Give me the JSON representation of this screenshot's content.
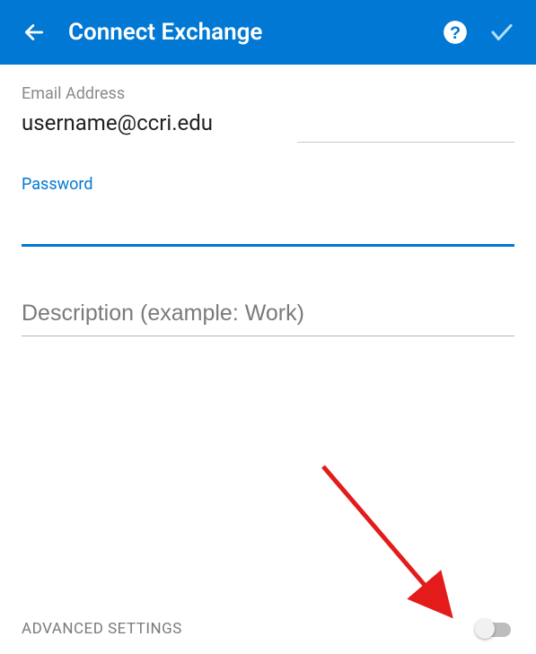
{
  "header": {
    "title": "Connect Exchange"
  },
  "fields": {
    "email_label": "Email Address",
    "email_value": "username@ccri.edu",
    "password_label": "Password",
    "password_value": "",
    "description_placeholder": "Description (example: Work)",
    "description_value": ""
  },
  "advanced": {
    "label": "ADVANCED SETTINGS",
    "enabled": false
  },
  "colors": {
    "primary": "#0078d4",
    "muted": "#8a8a8a"
  }
}
